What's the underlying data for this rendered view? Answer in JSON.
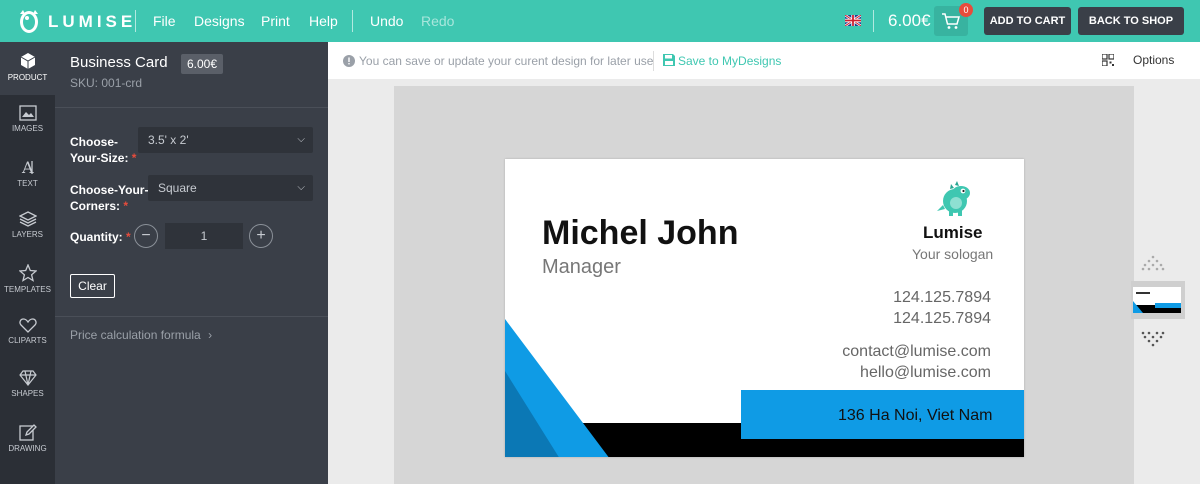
{
  "brand": {
    "logo_text": "LUMISE"
  },
  "menu": {
    "file": "File",
    "designs": "Designs",
    "print": "Print",
    "help": "Help",
    "undo": "Undo",
    "redo": "Redo"
  },
  "header": {
    "price": "6.00€",
    "cart_count": "0",
    "add_to_cart": "ADD TO CART",
    "back_to_shop": "BACK TO SHOP"
  },
  "nav": [
    {
      "label": "PRODUCT",
      "icon": "cube-icon"
    },
    {
      "label": "IMAGES",
      "icon": "image-icon"
    },
    {
      "label": "TEXT",
      "icon": "text-icon"
    },
    {
      "label": "LAYERS",
      "icon": "layers-icon"
    },
    {
      "label": "TEMPLATES",
      "icon": "star-icon"
    },
    {
      "label": "CLIPARTS",
      "icon": "heart-icon"
    },
    {
      "label": "SHAPES",
      "icon": "diamond-icon"
    },
    {
      "label": "DRAWING",
      "icon": "pencil-icon"
    }
  ],
  "product": {
    "title": "Business Card",
    "price": "6.00€",
    "sku": "SKU: 001-crd",
    "size_label_1": "Choose-",
    "size_label_2": "Your-Size:",
    "size_value": "3.5' x 2'",
    "corners_label_1": "Choose-Your-",
    "corners_label_2": "Corners:",
    "corners_value": "Square",
    "quantity_label": "Quantity:",
    "quantity_value": "1",
    "clear": "Clear",
    "formula": "Price calculation formula"
  },
  "notice": {
    "text": "You can save or update your curent design for later use",
    "save": "Save to MyDesigns",
    "options": "Options"
  },
  "card": {
    "name": "Michel John",
    "role": "Manager",
    "brand": "Lumise",
    "slogan": "Your sologan",
    "phone1": "124.125.7894",
    "phone2": "124.125.7894",
    "email1": "contact@lumise.com",
    "email2": "hello@lumise.com",
    "address": "136 Ha Noi, Viet Nam"
  },
  "colors": {
    "accent": "#3fc7b1",
    "card_blue": "#0f9be5",
    "panel": "#3a3f48"
  }
}
